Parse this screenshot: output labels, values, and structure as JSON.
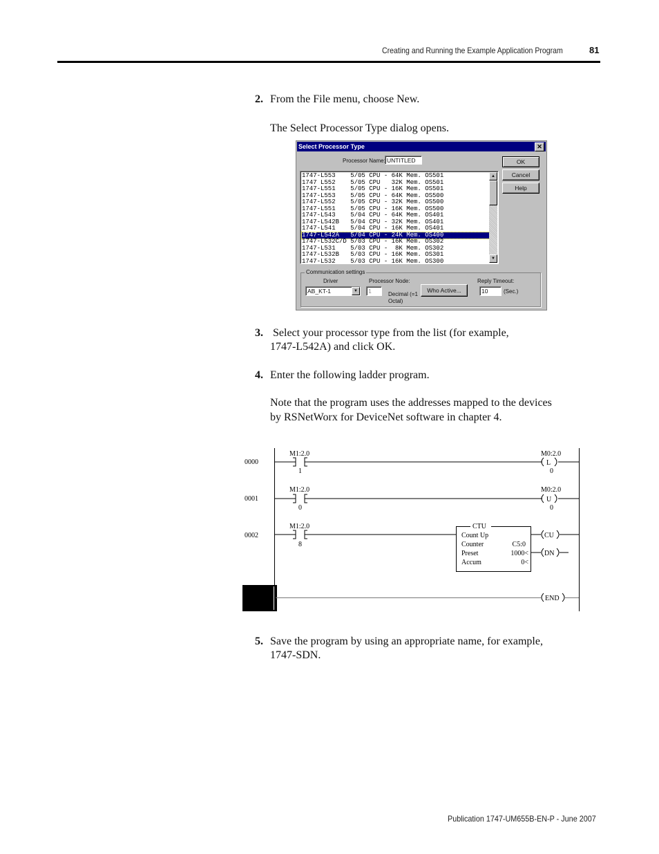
{
  "header": {
    "title": "Creating and Running the Example Application Program",
    "page_number": "81"
  },
  "steps": [
    {
      "number": "2.",
      "text": "From the File menu, choose New.",
      "followup": [
        "The Select Processor Type dialog opens."
      ]
    },
    {
      "number": "3.",
      "text_lines": [
        " Select your processor type from the list (for example,",
        "1747-L542A) and click OK."
      ]
    },
    {
      "number": "4.",
      "text": "Enter the following ladder program.",
      "followup": [
        "Note that the program uses the addresses mapped to the devices",
        "by RSNetWorx for DeviceNet software in chapter 4."
      ]
    },
    {
      "number": "5.",
      "text_lines": [
        "Save the program by using an appropriate name, for example,",
        "1747-SDN."
      ]
    }
  ],
  "dialog": {
    "title": "Select Processor Type",
    "close_icon": "close-icon",
    "processor_name_label": "Processor Name:",
    "processor_name_value": "UNTITLED",
    "buttons": {
      "ok": "OK",
      "cancel": "Cancel",
      "help": "Help"
    },
    "processors": [
      {
        "model": "1747-L553",
        "series": "5/05 CPU",
        "mem": "- 64K Mem.",
        "os": "OS501"
      },
      {
        "model": "1747 L552",
        "series": "5/05 CPU",
        "mem": "  32K Mem.",
        "os": "OS501"
      },
      {
        "model": "1747-L551",
        "series": "5/05 CPU",
        "mem": "- 16K Mem.",
        "os": "OS501"
      },
      {
        "model": "1747-L553",
        "series": "5/05 CPU",
        "mem": "- 64K Mem.",
        "os": "OS500"
      },
      {
        "model": "1747-L552",
        "series": "5/05 CPU",
        "mem": "- 32K Mem.",
        "os": "OS500"
      },
      {
        "model": "1747-L551",
        "series": "5/05 CPU",
        "mem": "- 16K Mem.",
        "os": "OS500"
      },
      {
        "model": "1747-L543",
        "series": "5/04 CPU",
        "mem": "- 64K Mem.",
        "os": "OS401"
      },
      {
        "model": "1747-L542B",
        "series": "5/04 CPU",
        "mem": "- 32K Mem.",
        "os": "OS401"
      },
      {
        "model": "1747-L541",
        "series": "5/04 CPU",
        "mem": "- 16K Mem.",
        "os": "OS401"
      },
      {
        "model": "1747-L542A",
        "series": "5/04 CPU",
        "mem": "- 24K Mem.",
        "os": "OS400",
        "selected": true
      },
      {
        "model": "1747-L532C/D",
        "series": "5/03 CPU",
        "mem": "- 16K Mem.",
        "os": "OS302"
      },
      {
        "model": "1747-L531",
        "series": "5/03 CPU",
        "mem": "-  8K Mem.",
        "os": "OS302"
      },
      {
        "model": "1747-L532B",
        "series": "5/03 CPU",
        "mem": "- 16K Mem.",
        "os": "OS301"
      },
      {
        "model": "1747-L532",
        "series": "5/03 CPU",
        "mem": "- 16K Mem.",
        "os": "OS300"
      }
    ],
    "comm": {
      "group_label": "Communication settings",
      "driver_label": "Driver",
      "driver_value": "AB_KT-1",
      "node_label": "Processor Node:",
      "node_value": "1",
      "node_hint_1": "Decimal (=1",
      "node_hint_2": "Octal)",
      "who_active": "Who Active...",
      "timeout_label": "Reply Timeout:",
      "timeout_value": "10",
      "timeout_unit": "(Sec.)"
    }
  },
  "ladder": {
    "rungs": [
      {
        "number": "0000",
        "input": {
          "address": "M1:2.0",
          "bit": "1"
        },
        "output": {
          "type": "L",
          "address": "M0:2.0",
          "bit": "0"
        }
      },
      {
        "number": "0001",
        "input": {
          "address": "M1:2.0",
          "bit": "0"
        },
        "output": {
          "type": "U",
          "address": "M0:2.0",
          "bit": "0"
        }
      },
      {
        "number": "0002",
        "input": {
          "address": "M1:2.0",
          "bit": "8"
        },
        "ctu": {
          "title": "CTU",
          "line1": "Count Up",
          "counter_label": "Counter",
          "counter_value": "C5:0",
          "preset_label": "Preset",
          "preset_value": "1000<",
          "accum_label": "Accum",
          "accum_value": "0<",
          "cu": "CU",
          "dn": "DN"
        }
      }
    ],
    "end_label": "END"
  },
  "footer": {
    "publication": "Publication 1747-UM655B-EN-P - June 2007"
  }
}
